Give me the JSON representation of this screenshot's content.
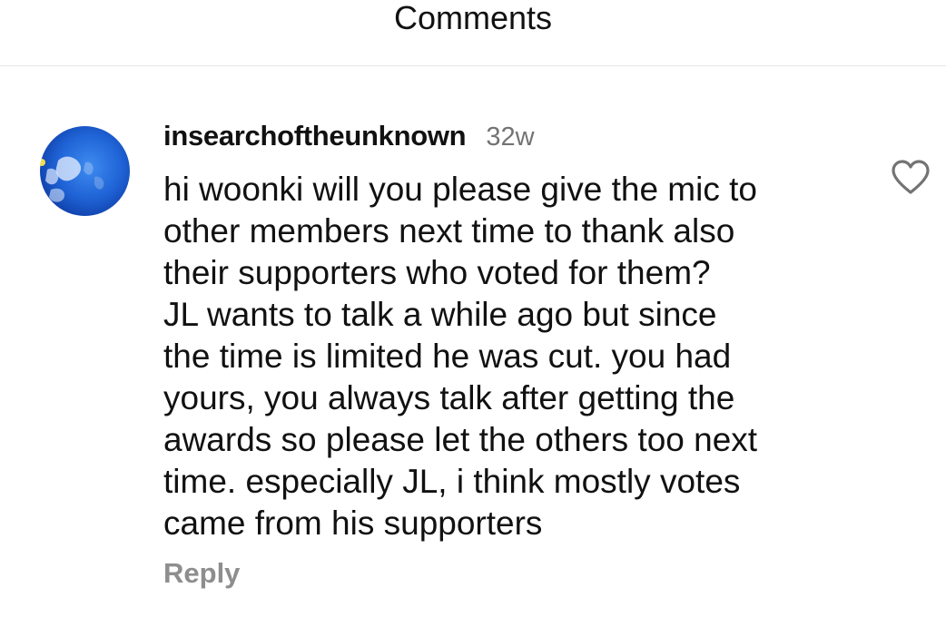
{
  "header": {
    "title": "Comments"
  },
  "comment": {
    "avatar_icon": "globe-avatar-icon",
    "username": "insearchoftheunknown",
    "timestamp": "32w",
    "text_lines": [
      "hi woonki will you please give the mic to",
      "other members next time to thank also",
      "their supporters who voted for them?",
      "JL wants to talk a while ago but since",
      "the time is limited he was cut. you had",
      "yours, you always talk after getting the",
      "awards so please let the others too next",
      "time. especially JL, i think mostly votes",
      "came from his supporters"
    ],
    "reply_label": "Reply",
    "like_icon": "heart-outline-icon"
  },
  "colors": {
    "text_primary": "#111111",
    "text_secondary": "#737373",
    "reply": "#8e8e8e",
    "divider": "#e6e6e6"
  }
}
